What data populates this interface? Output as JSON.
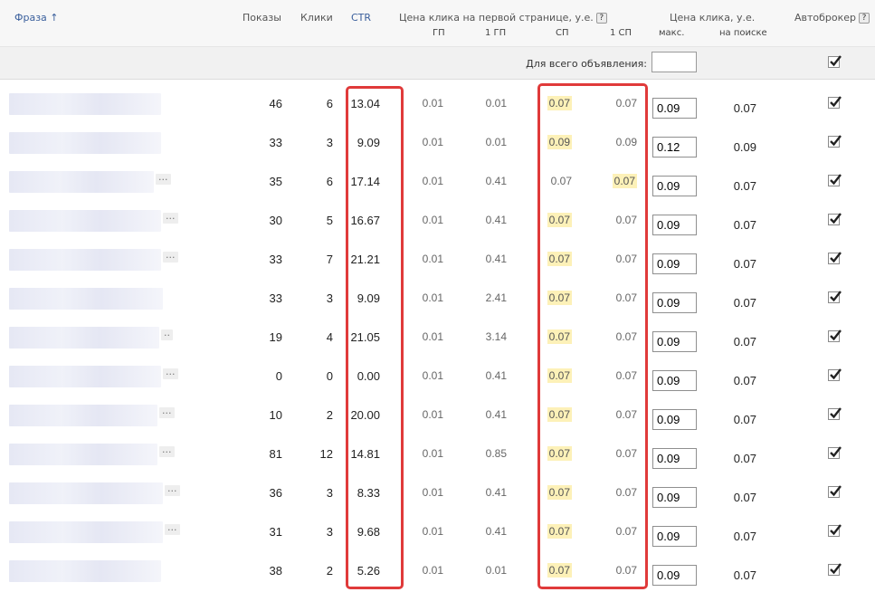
{
  "header": {
    "phrase": "Фраза",
    "shows": "Показы",
    "clicks": "Клики",
    "ctr": "CTR",
    "first_page_price": "Цена клика на первой странице, у.е.",
    "gp": "ГП",
    "one_gp": "1 ГП",
    "sp": "СП",
    "one_sp": "1 СП",
    "click_price": "Цена клика, у.е.",
    "max": "макс.",
    "on_search": "на поиске",
    "autobroker": "Автоброкер",
    "help": "?"
  },
  "all_ads": {
    "label": "Для всего объявления:",
    "value": ""
  },
  "icons": {
    "sort": "sort-arrow-up-icon",
    "help": "help-icon",
    "check": "checkbox-checked-icon",
    "more": "more-dots-icon"
  },
  "colors": {
    "highlight": "#fdf1b8",
    "box": "#e03a3a",
    "link": "#3a5f9c"
  },
  "rows": [
    {
      "shows": "46",
      "clicks": "6",
      "ctr": "13.04",
      "gp": "0.01",
      "one_gp": "0.01",
      "sp": "0.07",
      "one_sp": "0.07",
      "max": "0.09",
      "search": "0.07",
      "hl": "sp",
      "dots": "",
      "pw": 168
    },
    {
      "shows": "33",
      "clicks": "3",
      "ctr": "9.09",
      "gp": "0.01",
      "one_gp": "0.01",
      "sp": "0.09",
      "one_sp": "0.09",
      "max": "0.12",
      "search": "0.09",
      "hl": "sp",
      "dots": "",
      "pw": 168
    },
    {
      "shows": "35",
      "clicks": "6",
      "ctr": "17.14",
      "gp": "0.01",
      "one_gp": "0.41",
      "sp": "0.07",
      "one_sp": "0.07",
      "max": "0.09",
      "search": "0.07",
      "hl": "one_sp",
      "dots": "...",
      "pw": 160
    },
    {
      "shows": "30",
      "clicks": "5",
      "ctr": "16.67",
      "gp": "0.01",
      "one_gp": "0.41",
      "sp": "0.07",
      "one_sp": "0.07",
      "max": "0.09",
      "search": "0.07",
      "hl": "sp",
      "dots": "...",
      "pw": 168
    },
    {
      "shows": "33",
      "clicks": "7",
      "ctr": "21.21",
      "gp": "0.01",
      "one_gp": "0.41",
      "sp": "0.07",
      "one_sp": "0.07",
      "max": "0.09",
      "search": "0.07",
      "hl": "sp",
      "dots": "...",
      "pw": 168
    },
    {
      "shows": "33",
      "clicks": "3",
      "ctr": "9.09",
      "gp": "0.01",
      "one_gp": "2.41",
      "sp": "0.07",
      "one_sp": "0.07",
      "max": "0.09",
      "search": "0.07",
      "hl": "sp",
      "dots": "",
      "pw": 170
    },
    {
      "shows": "19",
      "clicks": "4",
      "ctr": "21.05",
      "gp": "0.01",
      "one_gp": "3.14",
      "sp": "0.07",
      "one_sp": "0.07",
      "max": "0.09",
      "search": "0.07",
      "hl": "sp",
      "dots": "..",
      "pw": 166
    },
    {
      "shows": "0",
      "clicks": "0",
      "ctr": "0.00",
      "gp": "0.01",
      "one_gp": "0.41",
      "sp": "0.07",
      "one_sp": "0.07",
      "max": "0.09",
      "search": "0.07",
      "hl": "sp",
      "dots": "...",
      "pw": 168
    },
    {
      "shows": "10",
      "clicks": "2",
      "ctr": "20.00",
      "gp": "0.01",
      "one_gp": "0.41",
      "sp": "0.07",
      "one_sp": "0.07",
      "max": "0.09",
      "search": "0.07",
      "hl": "sp",
      "dots": "...",
      "pw": 164
    },
    {
      "shows": "81",
      "clicks": "12",
      "ctr": "14.81",
      "gp": "0.01",
      "one_gp": "0.85",
      "sp": "0.07",
      "one_sp": "0.07",
      "max": "0.09",
      "search": "0.07",
      "hl": "sp",
      "dots": "...",
      "pw": 164
    },
    {
      "shows": "36",
      "clicks": "3",
      "ctr": "8.33",
      "gp": "0.01",
      "one_gp": "0.41",
      "sp": "0.07",
      "one_sp": "0.07",
      "max": "0.09",
      "search": "0.07",
      "hl": "sp",
      "dots": "...",
      "pw": 170
    },
    {
      "shows": "31",
      "clicks": "3",
      "ctr": "9.68",
      "gp": "0.01",
      "one_gp": "0.41",
      "sp": "0.07",
      "one_sp": "0.07",
      "max": "0.09",
      "search": "0.07",
      "hl": "sp",
      "dots": "...",
      "pw": 170
    },
    {
      "shows": "38",
      "clicks": "2",
      "ctr": "5.26",
      "gp": "0.01",
      "one_gp": "0.01",
      "sp": "0.07",
      "one_sp": "0.07",
      "max": "0.09",
      "search": "0.07",
      "hl": "sp",
      "dots": "",
      "pw": 168
    }
  ]
}
